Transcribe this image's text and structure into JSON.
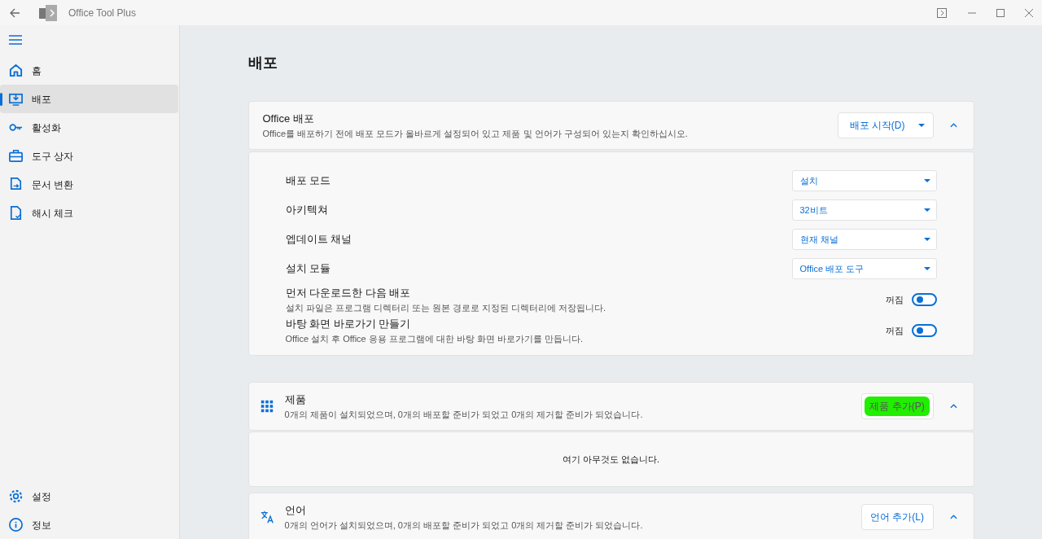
{
  "window": {
    "title": "Office Tool Plus"
  },
  "sidebar": {
    "items": [
      {
        "label": "홈",
        "selected": false
      },
      {
        "label": "배포",
        "selected": true
      },
      {
        "label": "활성화",
        "selected": false
      },
      {
        "label": "도구 상자",
        "selected": false
      },
      {
        "label": "문서 변환",
        "selected": false
      },
      {
        "label": "해시 체크",
        "selected": false
      }
    ],
    "footer_items": [
      {
        "label": "설정",
        "selected": false
      },
      {
        "label": "정보",
        "selected": false
      }
    ]
  },
  "page_title": "배포",
  "deploy": {
    "title": "Office 배포",
    "description": "Office를 배포하기 전에 배포 모드가 올바르게 설정되어 있고 제품 및 언어가 구성되어 있는지 확인하십시오.",
    "button": "배포 시작(D)",
    "expanded": true,
    "settings": [
      {
        "kind": "dropdown",
        "label": "배포 모드",
        "value": "설치"
      },
      {
        "kind": "dropdown",
        "label": "아키텍쳐",
        "value": "32비트"
      },
      {
        "kind": "dropdown",
        "label": "엡데이트 채널",
        "value": "현재 채널"
      },
      {
        "kind": "dropdown",
        "label": "설치 모듈",
        "value": "Office 배포 도구"
      },
      {
        "kind": "toggle",
        "label": "먼저 다운로드한 다음 배포",
        "description": "설치 파일은 프로그램 디렉터리 또는 원본 경로로 지정된 디렉터리에 저장됩니다.",
        "state_text": "꺼짐",
        "on": false
      },
      {
        "kind": "toggle",
        "label": "바탕 화면 바로가기 만들기",
        "description": "Office 설치 후 Office 응용 프로그램에 대한 바탕 화면 바로가기를 만듭니다.",
        "state_text": "꺼짐",
        "on": false
      }
    ]
  },
  "products": {
    "title": "제품",
    "description": "0개의 제품이 설치되었으며, 0개의 배포할 준비가 되었고 0개의 제거할 준비가 되었습니다.",
    "button": "제품 추가(P)",
    "button_highlighted": true,
    "expanded": true,
    "empty_text": "여기 아무것도 없습니다."
  },
  "languages": {
    "title": "언어",
    "description": "0개의 언어가 설치되었으며, 0개의 배포할 준비가 되었고 0개의 제거할 준비가 되었습니다.",
    "button": "언어 추가(L)",
    "expanded": true
  }
}
